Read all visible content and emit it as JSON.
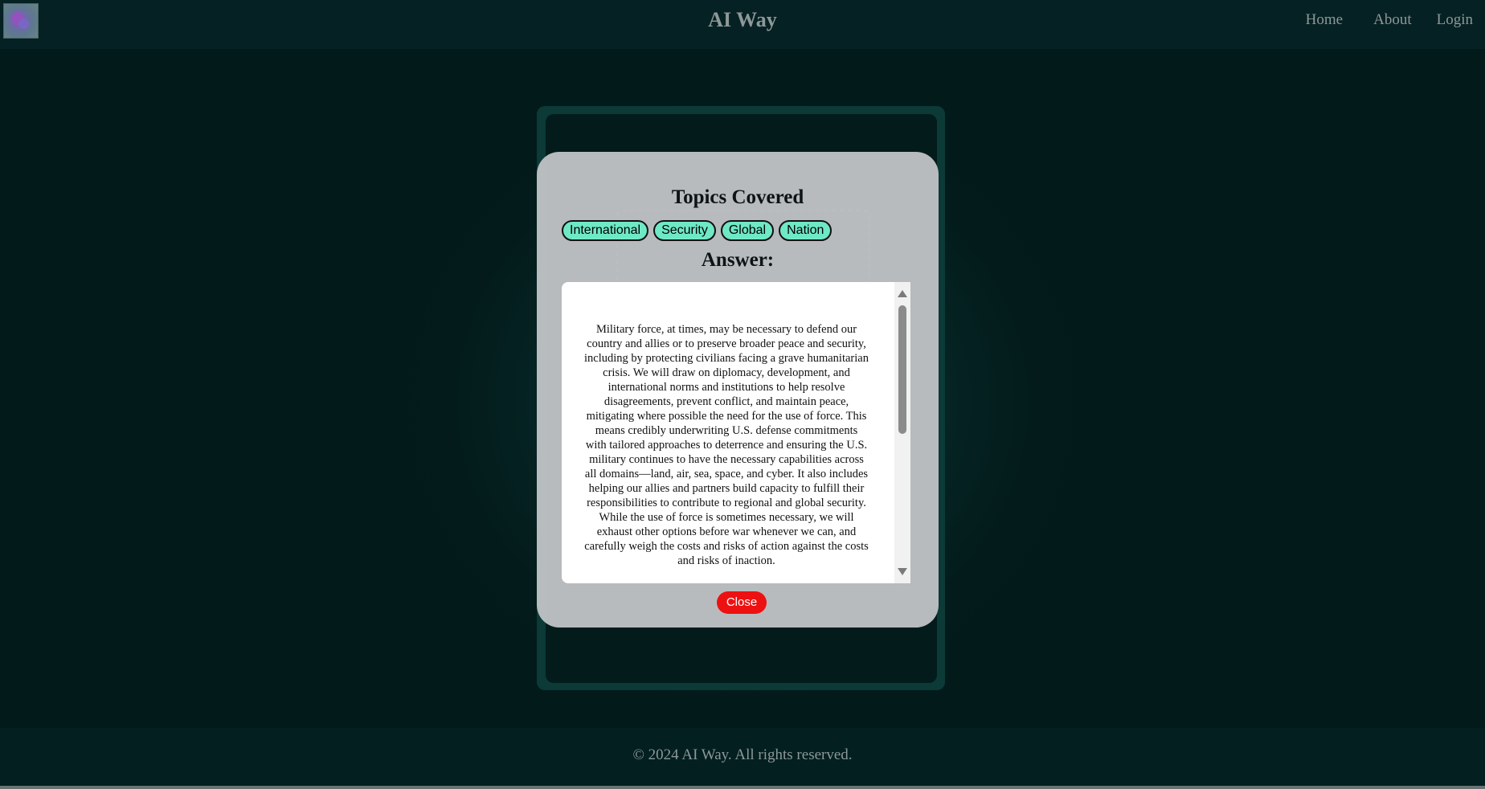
{
  "header": {
    "title": "AI Way",
    "nav": [
      "Home",
      "About",
      "Login"
    ]
  },
  "modal": {
    "title": "Topics Covered",
    "tags": [
      "International",
      "Security",
      "Global",
      "Nation"
    ],
    "answer_label": "Answer:",
    "answer_text": "Military force, at times, may be necessary to defend our country and allies or to preserve broader peace and security, including by protecting civilians facing a grave humanitarian crisis. We will draw on diplomacy, development, and international norms and institutions to help resolve disagreements, prevent conflict, and maintain peace, mitigating where possible the need for the use of force. This means credibly underwriting U.S. defense commitments with tailored approaches to deterrence and ensuring the U.S. military continues to have the necessary capabilities across all domains—land, air, sea, space, and cyber. It also includes helping our allies and partners build capacity to fulfill their responsibilities to contribute to regional and global security. While the use of force is sometimes necessary, we will exhaust other options before war whenever we can, and carefully weigh the costs and risks of action against the costs and risks of inaction.",
    "close_label": "Close"
  },
  "footer": {
    "text": "© 2024 AI Way. All rights reserved."
  },
  "colors": {
    "background": "#031a1a",
    "tag_fill": "#6fe8c5",
    "close_button": "#ee1111",
    "modal": "#bec2c4"
  }
}
